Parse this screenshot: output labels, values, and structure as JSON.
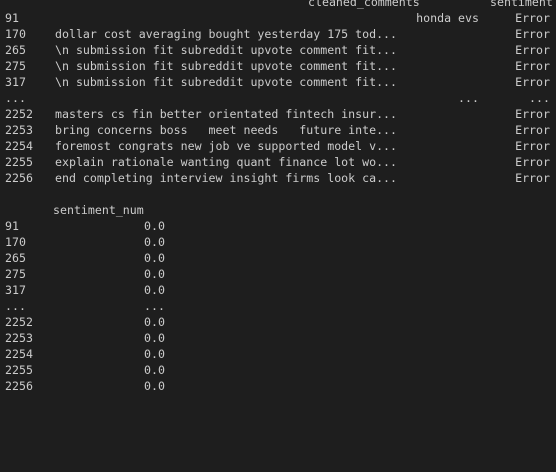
{
  "table1": {
    "header_comment": "cleaned_comments",
    "header_sentiment": "sentiment",
    "rows": [
      {
        "index": "91",
        "comment": "honda evs",
        "sentiment": "Error",
        "align": "right"
      },
      {
        "index": "170",
        "comment": "dollar cost averaging bought yesterday 175 tod...",
        "sentiment": "Error",
        "align": "left"
      },
      {
        "index": "265",
        "comment": "\\n submission fit subreddit upvote comment fit...",
        "sentiment": "Error",
        "align": "left"
      },
      {
        "index": "275",
        "comment": "\\n submission fit subreddit upvote comment fit...",
        "sentiment": "Error",
        "align": "left"
      },
      {
        "index": "317",
        "comment": "\\n submission fit subreddit upvote comment fit...",
        "sentiment": "Error",
        "align": "left"
      },
      {
        "index": "...",
        "comment": "...",
        "sentiment": "...",
        "align": "right"
      },
      {
        "index": "2252",
        "comment": "masters cs fin better orientated fintech insur...",
        "sentiment": "Error",
        "align": "left"
      },
      {
        "index": "2253",
        "comment": "bring concerns boss   meet needs   future inte...",
        "sentiment": "Error",
        "align": "left"
      },
      {
        "index": "2254",
        "comment": "foremost congrats new job ve supported model v...",
        "sentiment": "Error",
        "align": "left"
      },
      {
        "index": "2255",
        "comment": "explain rationale wanting quant finance lot wo...",
        "sentiment": "Error",
        "align": "left"
      },
      {
        "index": "2256",
        "comment": "end completing interview insight firms look ca...",
        "sentiment": "Error",
        "align": "left"
      }
    ]
  },
  "table2": {
    "header": "sentiment_num",
    "rows": [
      {
        "index": "91",
        "value": "0.0"
      },
      {
        "index": "170",
        "value": "0.0"
      },
      {
        "index": "265",
        "value": "0.0"
      },
      {
        "index": "275",
        "value": "0.0"
      },
      {
        "index": "317",
        "value": "0.0"
      },
      {
        "index": "...",
        "value": "..."
      },
      {
        "index": "2252",
        "value": "0.0"
      },
      {
        "index": "2253",
        "value": "0.0"
      },
      {
        "index": "2254",
        "value": "0.0"
      },
      {
        "index": "2255",
        "value": "0.0"
      },
      {
        "index": "2256",
        "value": "0.0"
      }
    ]
  }
}
